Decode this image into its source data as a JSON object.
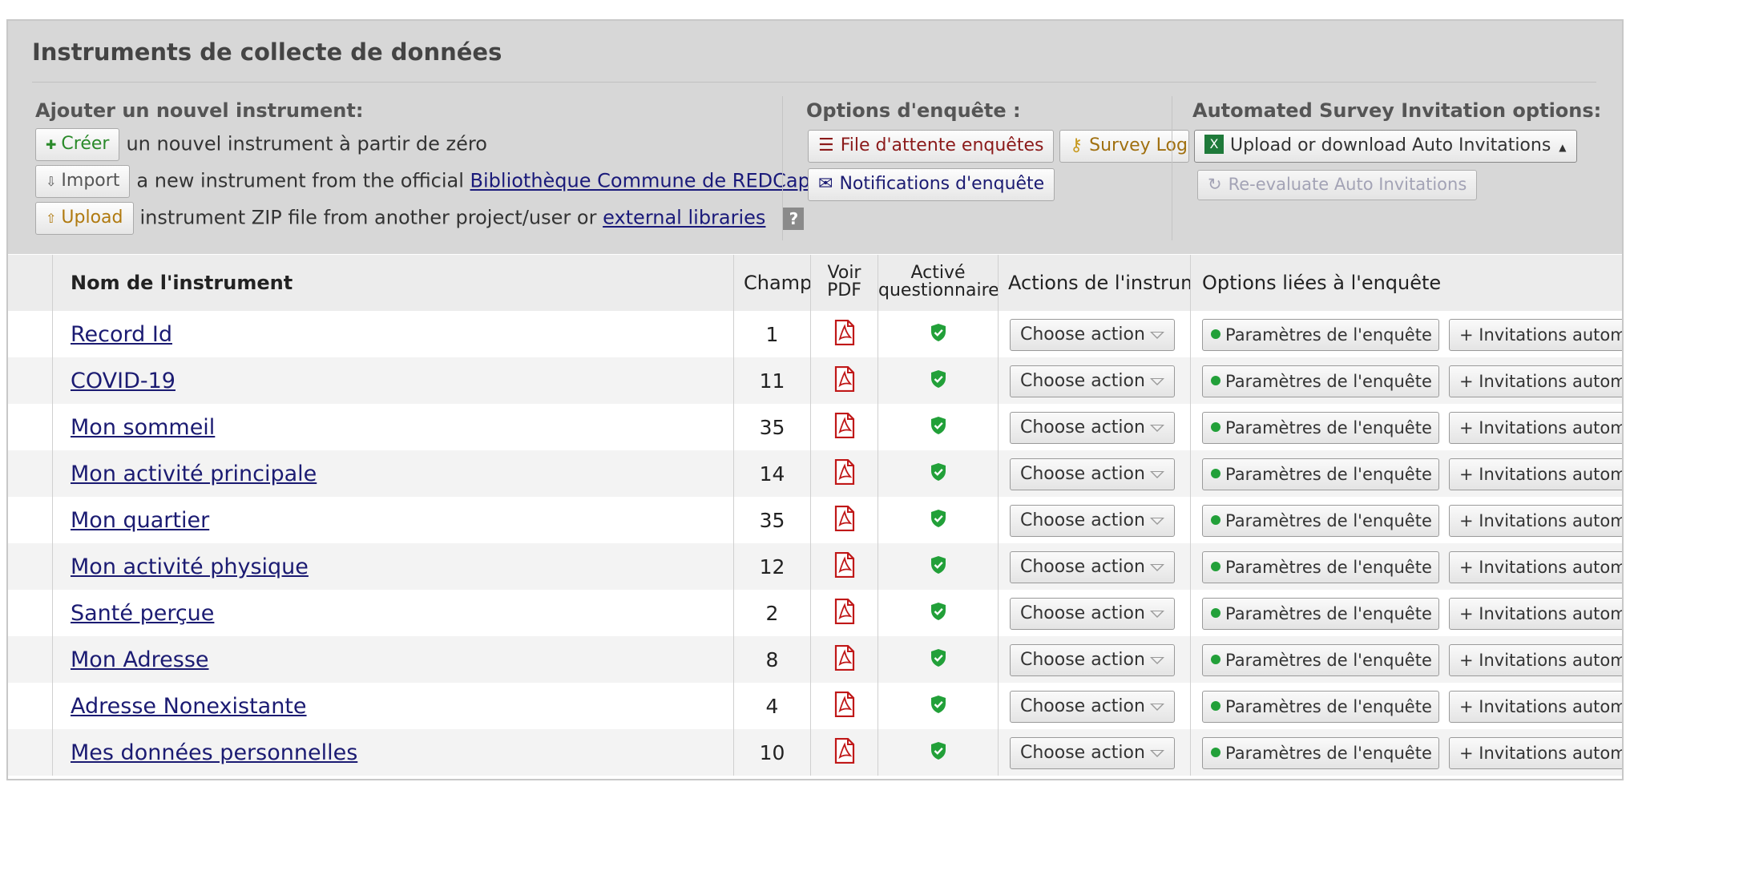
{
  "panel": {
    "title": "Instruments de collecte de données"
  },
  "add_section": {
    "heading": "Ajouter un nouvel instrument:",
    "create_button": "Créer",
    "create_text": "un nouvel instrument à partir de zéro",
    "import_button": "Import",
    "import_text": "a new instrument from the official",
    "import_link": "Bibliothèque Commune de REDCap (REDCap Shared Library)",
    "upload_button": "Upload",
    "upload_text": "instrument ZIP file from another project/user or",
    "upload_link": "external libraries",
    "help_label": "?"
  },
  "survey_options": {
    "heading": "Options d'enquête :",
    "queue_button": "File d'attente enquêtes",
    "login_button": "Survey Login",
    "notifications_button": "Notifications d'enquête"
  },
  "auto_invitations": {
    "heading": "Automated Survey Invitation options:",
    "upload_download_button": "Upload or download Auto Invitations",
    "reevaluate_button": "Re-evaluate Auto Invitations"
  },
  "table": {
    "columns": {
      "name": "Nom de l'instrument",
      "fields": "Champs",
      "pdf_line1": "Voir",
      "pdf_line2": "PDF",
      "survey_line1": "Activé",
      "survey_line2": "questionnaire",
      "actions": "Actions de l'instrument",
      "survey_options": "Options liées à l'enquête"
    },
    "action_select_label": "Choose action",
    "survey_settings_label": "Paramètres de l'enquête",
    "auto_invitations_label": "+ Invitations automatiques",
    "rows": [
      {
        "name": "Record Id",
        "fields": "1"
      },
      {
        "name": "COVID-19",
        "fields": "11"
      },
      {
        "name": "Mon sommeil",
        "fields": "35"
      },
      {
        "name": "Mon activité principale",
        "fields": "14"
      },
      {
        "name": "Mon quartier",
        "fields": "35"
      },
      {
        "name": "Mon activité physique",
        "fields": "12"
      },
      {
        "name": "Santé perçue",
        "fields": "2"
      },
      {
        "name": "Mon Adresse",
        "fields": "8"
      },
      {
        "name": "Adresse Nonexistante",
        "fields": "4"
      },
      {
        "name": "Mes données personnelles",
        "fields": "10"
      }
    ]
  },
  "colors": {
    "header_bg": "#d7d7d7",
    "link_blue": "#1b1b72",
    "pdf_red": "#c01818",
    "shield_green": "#22a039",
    "create_green": "#2a8a2a",
    "queue_red": "#8b1a1a"
  }
}
